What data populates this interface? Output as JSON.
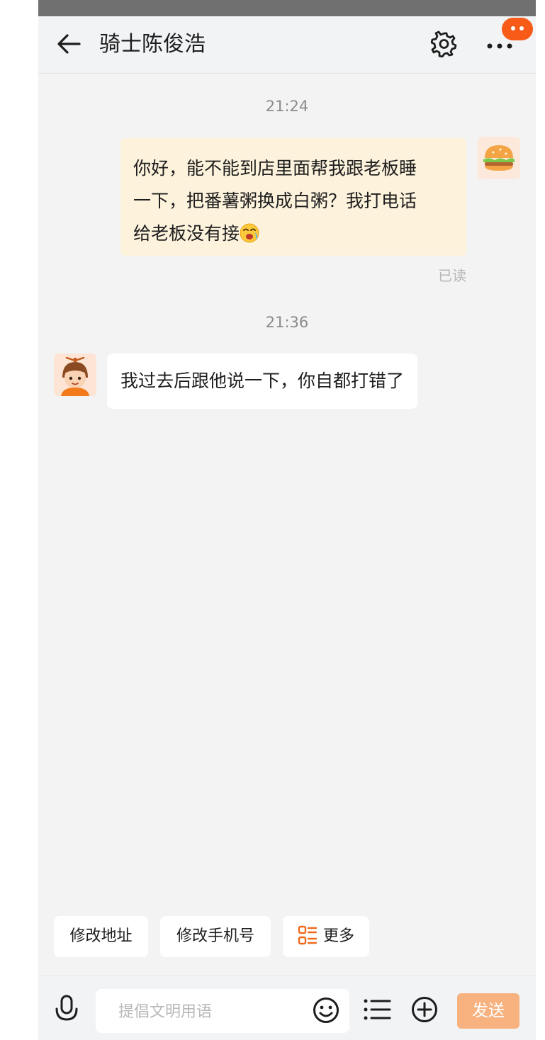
{
  "header": {
    "title": "骑士陈俊浩",
    "back_icon": "arrow-left-icon",
    "settings_icon": "gear-icon",
    "more_icon": "ellipsis-icon"
  },
  "messages": [
    {
      "time": "21:24",
      "direction": "outgoing",
      "lines": [
        "你好，能不能到店里面帮我跟老板睡",
        "一下，把番薯粥换成白粥？我打电话",
        "给老板没有接"
      ],
      "emoji": "crying-face-emoji",
      "status": "已读"
    },
    {
      "time": "21:36",
      "direction": "incoming",
      "text": "我过去后跟他说一下，你自都打错了"
    }
  ],
  "quick_replies": [
    "修改地址",
    "修改手机号",
    "更多"
  ],
  "composer": {
    "placeholder": "提倡文明用语",
    "send_label": "发送",
    "mic_icon": "microphone-icon",
    "emoji_icon": "smiley-icon",
    "list_icon": "list-icon",
    "plus_icon": "plus-circle-icon"
  },
  "colors": {
    "accent": "#f85a17",
    "send_button": "#f8b27f",
    "outgoing_bubble": "#fdf3dd",
    "background": "#f3f3f3"
  }
}
